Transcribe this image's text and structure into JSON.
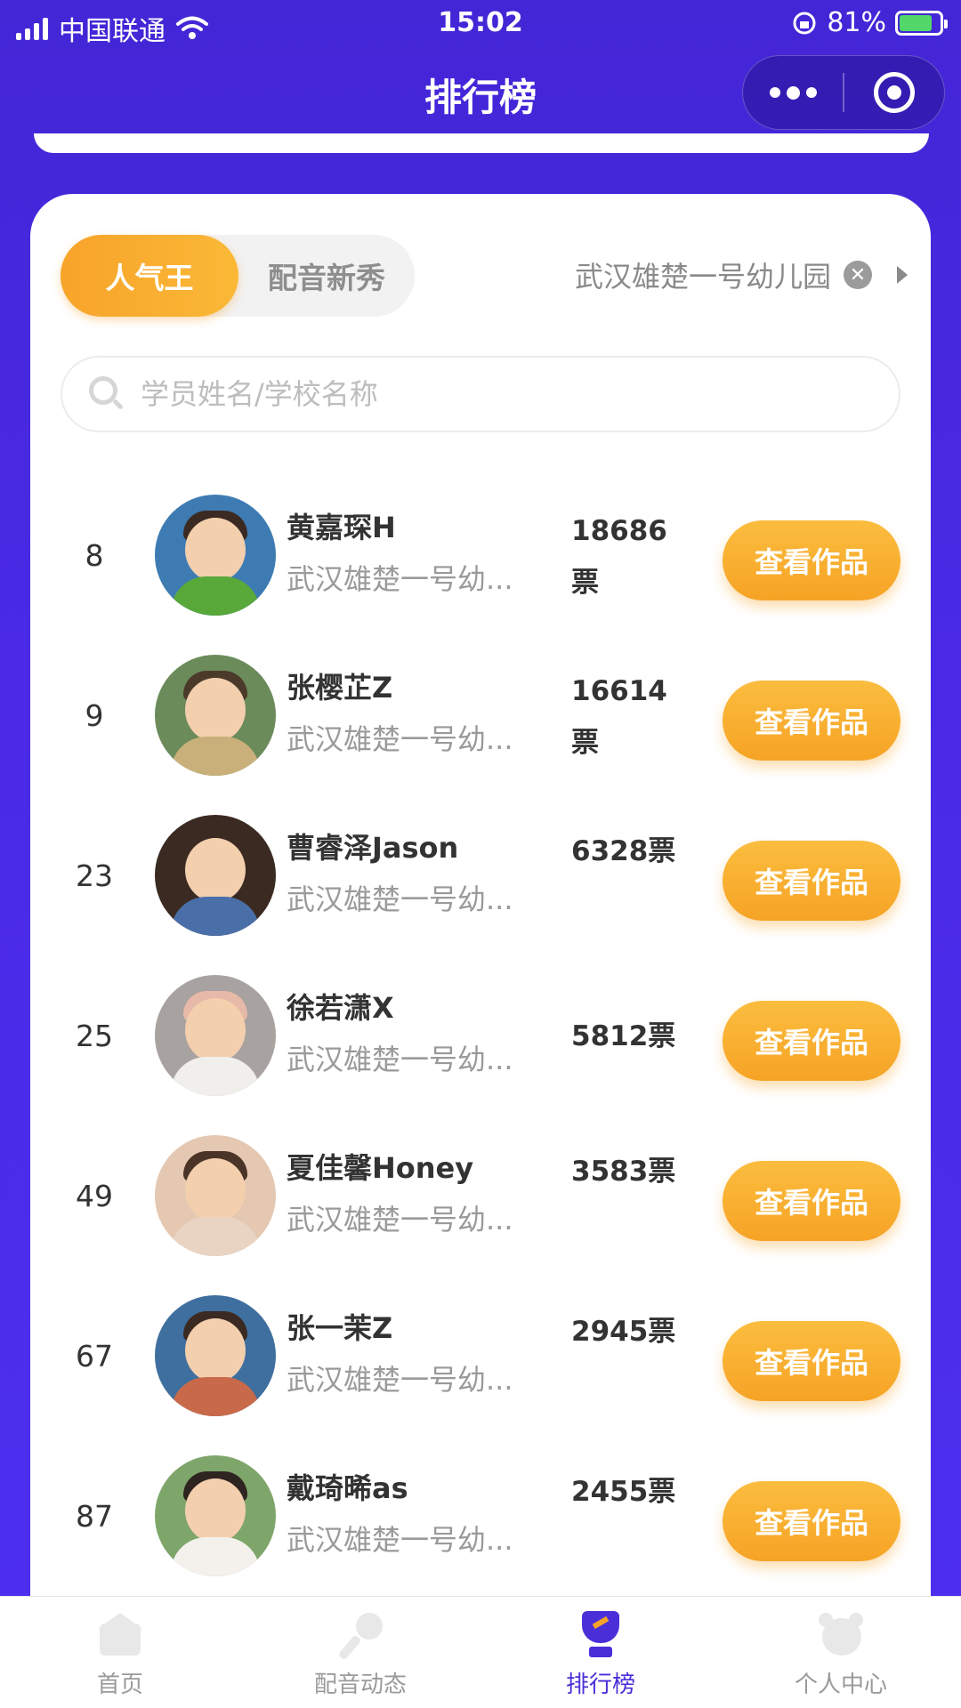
{
  "status_bar": {
    "carrier": "中国联通",
    "time": "15:02",
    "battery": "81%",
    "battery_level": 0.81
  },
  "nav": {
    "title": "排行榜"
  },
  "tabs": {
    "active": "人气王",
    "inactive": "配音新秀"
  },
  "filter": {
    "school": "武汉雄楚一号幼儿园"
  },
  "search": {
    "placeholder": "学员姓名/学校名称"
  },
  "colors": {
    "accent": "#f6a325",
    "brand": "#4a2fd8"
  },
  "view_button_label": "查看作品",
  "entries": [
    {
      "rank": "8",
      "name": "黄嘉琛H",
      "school": "武汉雄楚一号幼...",
      "votes": "18686票"
    },
    {
      "rank": "9",
      "name": "张樱芷Z",
      "school": "武汉雄楚一号幼...",
      "votes": "16614票"
    },
    {
      "rank": "23",
      "name": "曹睿泽Jason",
      "school": "武汉雄楚一号幼...",
      "votes": "6328票"
    },
    {
      "rank": "25",
      "name": "徐若潇X",
      "school": "武汉雄楚一号幼...",
      "votes": "5812票"
    },
    {
      "rank": "49",
      "name": "夏佳馨Honey",
      "school": "武汉雄楚一号幼...",
      "votes": "3583票"
    },
    {
      "rank": "67",
      "name": "张一茉Z",
      "school": "武汉雄楚一号幼...",
      "votes": "2945票"
    },
    {
      "rank": "87",
      "name": "戴琦晞as",
      "school": "武汉雄楚一号幼...",
      "votes": "2455票"
    }
  ],
  "tabbar": [
    {
      "label": "首页",
      "icon": "home-icon"
    },
    {
      "label": "配音动态",
      "icon": "microphone-icon"
    },
    {
      "label": "排行榜",
      "icon": "trophy-icon"
    },
    {
      "label": "个人中心",
      "icon": "bear-icon"
    }
  ]
}
